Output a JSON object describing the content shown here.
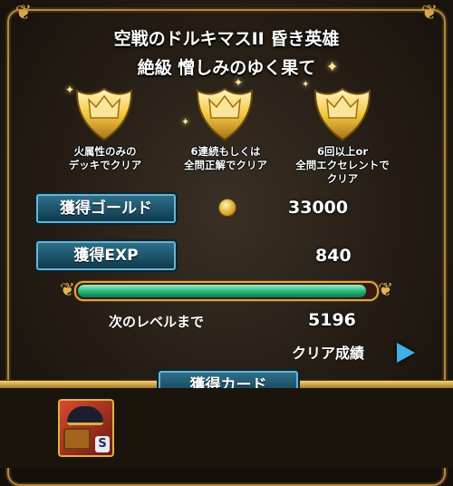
{
  "quest": {
    "title_line1": "空戦のドルキマスII 昏き英雄",
    "title_line2": "絶級 憎しみのゆく果て"
  },
  "conditions": [
    {
      "text": "火属性のみの\nデッキでクリア",
      "icon": "gold-trophy-icon"
    },
    {
      "text": "6連続もしくは\n全問正解でクリア",
      "icon": "gold-trophy-icon"
    },
    {
      "text": "6回以上or\n全問エクセレントで\nクリア",
      "icon": "gold-trophy-icon"
    }
  ],
  "rewards": {
    "gold_label": "獲得ゴールド",
    "gold_value": "33000",
    "exp_label": "獲得EXP",
    "exp_value": "840",
    "exp_progress": 0.97,
    "next_level_label": "次のレベルまで",
    "next_level_value": "5196",
    "clear_results_label": "クリア成績"
  },
  "cards": {
    "header_label": "獲得カード",
    "items": [
      {
        "rarity": "S",
        "icon": "treasure-chest-card-icon"
      }
    ]
  },
  "colors": {
    "accent_gold": "#d8a849",
    "label_blue": "#2f6f8a",
    "exp_green": "#21b277",
    "play_arrow": "#3fb0e6"
  }
}
